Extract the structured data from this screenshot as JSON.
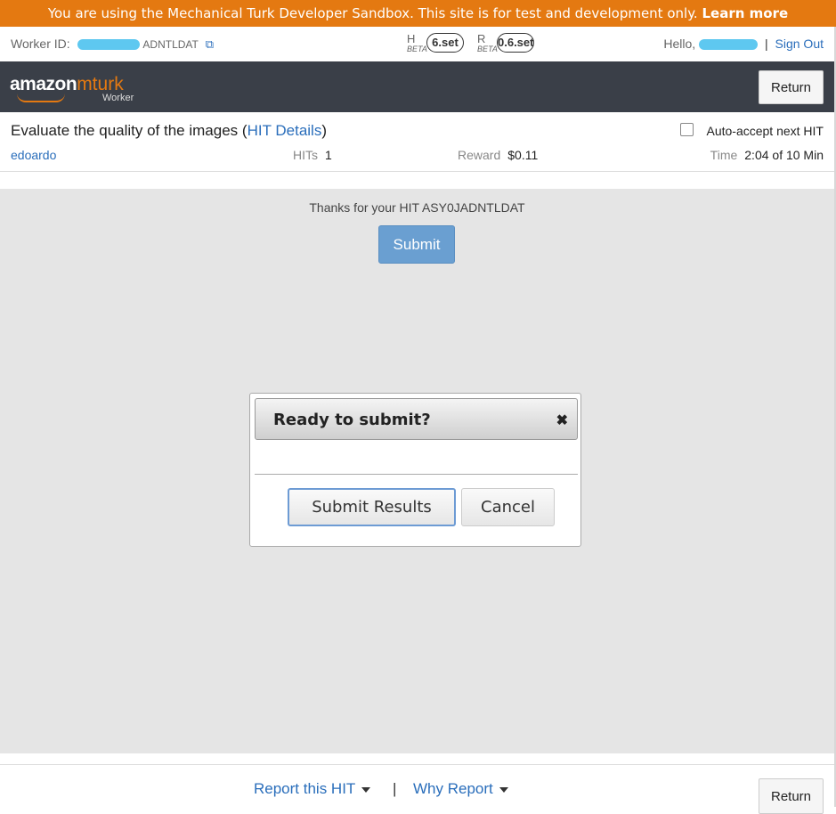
{
  "banner": {
    "text": "You are using the Mechanical Turk Developer Sandbox. This site is for test and development only.",
    "link": "Learn more"
  },
  "worker_bar": {
    "worker_id_label": "Worker ID:",
    "worker_id_value": "ADNTLDAT",
    "copy_icon": "copy-icon",
    "h_letter": "H",
    "h_beta": "BETA",
    "h_value": "6.set",
    "r_letter": "R",
    "r_beta": "BETA",
    "r_value": "0.6.set",
    "hello": "Hello,",
    "separator": "|",
    "sign_out": "Sign Out"
  },
  "header": {
    "logo_amazon": "amazon",
    "logo_mturk": "mturk",
    "logo_worker": "Worker",
    "return_label": "Return"
  },
  "hit": {
    "title": "Evaluate the quality of the images",
    "details_link": "HIT Details",
    "requester": "edoardo",
    "hits_label": "HITs",
    "hits_value": "1",
    "reward_label": "Reward",
    "reward_value": "$0.11",
    "time_label": "Time",
    "time_value": "2:04 of 10 Min",
    "auto_accept_label": "Auto-accept next HIT",
    "auto_accept_checked": false
  },
  "work": {
    "thanks_text": "Thanks for your HIT ASY0JADNTLDAT",
    "submit_label": "Submit"
  },
  "dialog": {
    "title": "Ready to submit?",
    "close_glyph": "✖",
    "submit_results_label": "Submit Results",
    "cancel_label": "Cancel"
  },
  "footer": {
    "report_label": "Report this HIT",
    "separator": "|",
    "why_report_label": "Why Report",
    "return_label": "Return"
  },
  "colors": {
    "banner": "#e47911",
    "header": "#3a3f48",
    "link": "#2a6ebb",
    "work_bg": "#e5e5e5",
    "submit_btn": "#6a9fd1"
  }
}
